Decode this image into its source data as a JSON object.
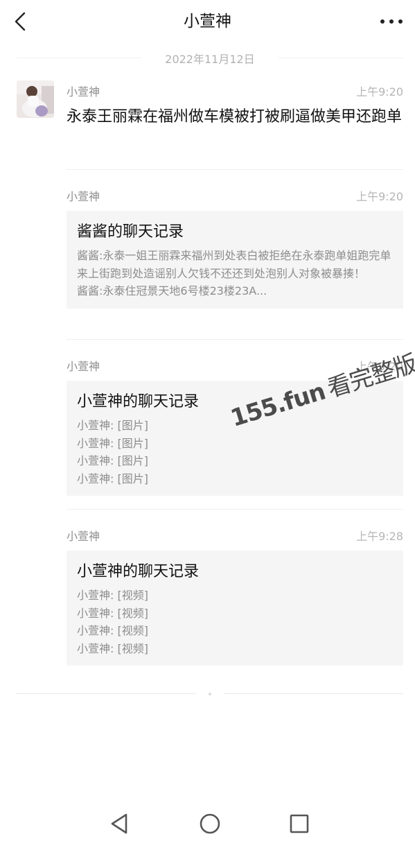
{
  "header": {
    "title": "小萱神",
    "back_icon": "chevron-left-icon",
    "more_icon": "more-horizontal-icon"
  },
  "date_separator": "2022年11月12日",
  "messages": [
    {
      "sender": "小萱神",
      "time": "上午9:20",
      "text": "永泰王丽霖在福州做车模被打被刷逼做美甲还跑单"
    },
    {
      "sender": "小萱神",
      "time": "上午9:20",
      "card": {
        "title": "酱酱的聊天记录",
        "lines": [
          "酱酱:永泰一姐王丽霖来福州到处表白被拒绝在永泰跑单姐跑完单来上街跑到处造谣别人欠钱不还还到处泡别人对象被暴揍！",
          "酱酱:永泰住冠景天地6号楼23楼23A..."
        ]
      }
    },
    {
      "sender": "小萱神",
      "time": "上午9:20",
      "card": {
        "title": "小萱神的聊天记录",
        "lines": [
          "小萱神: [图片]",
          "小萱神: [图片]",
          "小萱神: [图片]",
          "小萱神: [图片]"
        ]
      }
    },
    {
      "sender": "小萱神",
      "time": "上午9:28",
      "card": {
        "title": "小萱神的聊天记录",
        "lines": [
          "小萱神: [视频]",
          "小萱神: [视频]",
          "小萱神: [视频]",
          "小萱神: [视频]"
        ]
      }
    }
  ],
  "watermark": {
    "latin": "155.fun",
    "chinese": "看完整版"
  },
  "system_nav": {
    "back_icon": "triangle-back-icon",
    "home_icon": "circle-home-icon",
    "recents_icon": "square-recents-icon"
  },
  "colors": {
    "card_bg": "#f5f5f5",
    "meta_text": "#8e8e8e",
    "time_text": "#b5b5b5"
  }
}
